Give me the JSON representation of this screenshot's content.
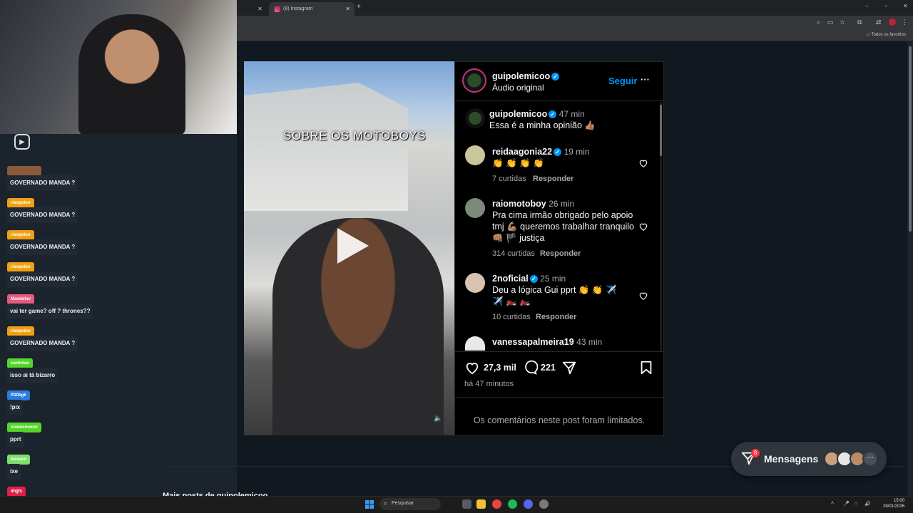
{
  "browser": {
    "tabs": [
      {
        "label": ""
      },
      {
        "label": "(8) Instagram"
      }
    ],
    "bookmarks_folder": "Todos os favoritos"
  },
  "chat": {
    "messages": [
      {
        "user": "",
        "badge_color": "#8a5a3a",
        "text": "GOVERNADO MANDA ?"
      },
      {
        "user": "rianpobre",
        "badge_color": "#f0a010",
        "text": "GOVERNADO MANDA ?"
      },
      {
        "user": "rianpobre",
        "badge_color": "#f0a010",
        "text": "GOVERNADO MANDA ?"
      },
      {
        "user": "rianpobre",
        "badge_color": "#f0a010",
        "text": "GOVERNADO MANDA ?"
      },
      {
        "user": "Mandoluv",
        "badge_color": "#e85a80",
        "text": "vai ter game? off ? thrones??"
      },
      {
        "user": "rianpobre",
        "badge_color": "#f0a010",
        "text": "GOVERNADO MANDA ?"
      },
      {
        "user": "cachinas",
        "badge_color": "#53d62a",
        "text": "isso ai tá bizarro"
      },
      {
        "user": "R10bgk",
        "badge_color": "#2a7be0",
        "text": "!pix"
      },
      {
        "user": "oioioioiooooi",
        "badge_color": "#53d62a",
        "text": "pprt"
      },
      {
        "user": "lucasco",
        "badge_color": "#7ee06a",
        "text": "ixe"
      },
      {
        "user": "dhjjfs",
        "badge_color": "#e0204a",
        "text": ""
      }
    ]
  },
  "post": {
    "video_caption": "SOBRE OS MOTOBOYS",
    "author": "guipolemicoo",
    "audio": "Áudio original",
    "follow_label": "Seguir",
    "more_label": "···",
    "caption_text": "Essa é a minha opinião 👍🏽",
    "caption_time": "47 min",
    "likes": "27,3 mil",
    "comments_count": "221",
    "posted_ago": "há 47 minutos",
    "limited_notice": "Os comentários neste post foram limitados.",
    "comments": [
      {
        "user": "reidaagonia22",
        "time": "19 min",
        "text": "👏 👏 👏 👏",
        "likes": "7 curtidas",
        "reply": "Responder"
      },
      {
        "user": "raiomotoboy",
        "time": "26 min",
        "text": "Pra cima irmão obrigado pelo apoio tmj 💪🏽 queremos trabalhar tranquilo 👊🏽 🏴 justiça",
        "likes": "314 curtidas",
        "reply": "Responder"
      },
      {
        "user": "2noficial",
        "time": "25 min",
        "text": "Deu a lógica Gui pprt 👏 👏 ✈️ ✈️ 🏍️ 🏍️",
        "likes": "10 curtidas",
        "reply": "Responder"
      },
      {
        "user": "vanessapalmeira19",
        "time": "43 min",
        "text": "",
        "likes": "",
        "reply": ""
      }
    ]
  },
  "messages_widget": {
    "label": "Mensagens",
    "badge": "8"
  },
  "page_footer": {
    "more_posts": "Mais posts de guipolemicoo"
  },
  "taskbar": {
    "search_placeholder": "Pesquisar",
    "time": "15:00",
    "date": "29/01/2026"
  }
}
